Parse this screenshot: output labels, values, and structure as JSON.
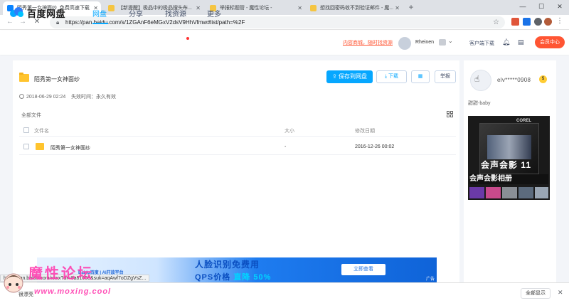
{
  "browser": {
    "tabs": [
      {
        "title": "陌秀第一女神面纱_免费高速下载",
        "active": true
      },
      {
        "title": "【新提醒】极品中的极品搜头布..."
      },
      {
        "title": "举报标题管 - 魔性论坛 -"
      },
      {
        "title": "想找回密码收不到验证邮件 - 魔..."
      }
    ],
    "url": "https://pan.baidu.com/s/1ZGAnF6eMGxV2dsV9HhVfmw#list/path=%2F"
  },
  "header": {
    "logo": "百度网盘",
    "nav": [
      "网盘",
      "分享",
      "找资源",
      "更多"
    ],
    "promo": "内容商城，随时找资源",
    "username": "Rheinen",
    "client": "客户端下载",
    "member_button": "会员中心"
  },
  "share": {
    "title": "陌秀第一女神面纱",
    "date": "2018-06-29 02:24",
    "expiry": "失效时间：永久有效",
    "save_button": "保存到网盘",
    "download_button": "下载",
    "report_button": "举报",
    "breadcrumb": "全部文件"
  },
  "table": {
    "headers": [
      "文件名",
      "大小",
      "修改日期"
    ],
    "rows": [
      {
        "name": "陌秀第一女神面纱",
        "size": "-",
        "modified": "2016-12-26 00:02"
      }
    ]
  },
  "sidebar": {
    "user": "elv*****0908",
    "level": "5",
    "subtitle": "甜甜-baby",
    "ad": {
      "brand": "COREL",
      "product": "会声会影",
      "version": "11",
      "caption": "会声会影相册"
    }
  },
  "banner": {
    "logo": "Baidu百度 | AI开放平台",
    "title": "人脸识别免费用",
    "subtitle_prefix": "QPS价格",
    "subtitle_highlight": "直降 50%",
    "button": "立即查看",
    "ad_label": "广告"
  },
  "status_url": "http://wan.baidu.com/xxxx?dr=8a81008&suk=aqAwf7oDZgVsZ...",
  "downloads": {
    "item": "很漂亮",
    "show_all": "全部显示"
  },
  "watermark": {
    "text": "魔性论坛",
    "url": "www.moxing.cool"
  },
  "colors": {
    "accent": "#06a7ff",
    "member": "#ff5533",
    "watermark": "#ff3fb0"
  }
}
